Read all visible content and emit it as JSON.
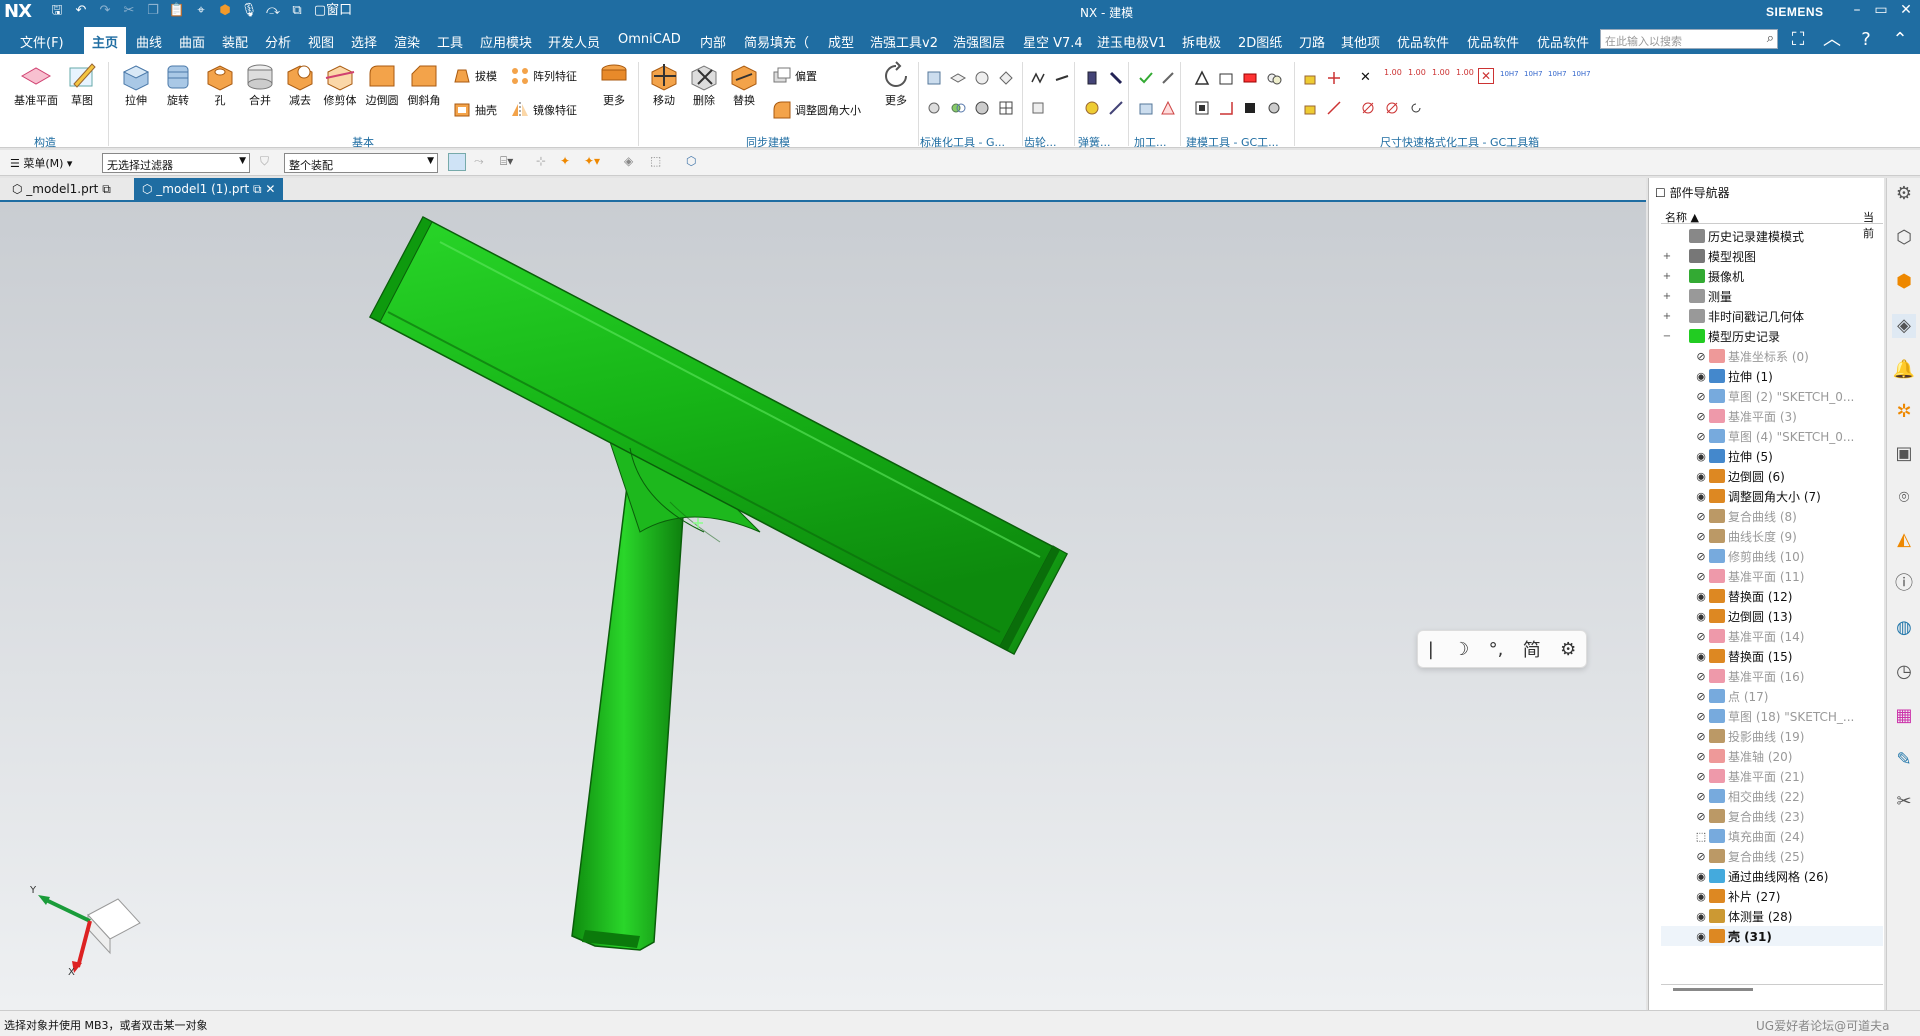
{
  "app": {
    "logo": "NX",
    "title": "NX - 建模",
    "brand": "SIEMENS"
  },
  "menubar": {
    "file": "文件(F)",
    "tabs": [
      "主页",
      "曲线",
      "曲面",
      "装配",
      "分析",
      "视图",
      "选择",
      "渲染",
      "工具",
      "应用模块",
      "开发人员",
      "OmniCAD",
      "内部",
      "简易填充（",
      "成型",
      "浩强工具v2",
      "浩强图层",
      "星空 V7.4",
      "进玉电极V1",
      "拆电极",
      "2D图纸",
      "刀路",
      "其他项",
      "优品软件",
      "优品软件",
      "优品软件"
    ],
    "active_index": 0,
    "search_placeholder": "在此输入以搜索"
  },
  "ribbon": {
    "construct": {
      "buttons": [
        "基准平面",
        "草图"
      ],
      "group": "构造"
    },
    "basic": {
      "buttons": [
        "拉伸",
        "旋转",
        "孔",
        "合并",
        "减去",
        "修剪体",
        "边倒圆",
        "倒斜角",
        "更多"
      ],
      "small": [
        "拔模",
        "抽壳",
        "阵列特征",
        "镜像特征"
      ],
      "group": "基本"
    },
    "sync": {
      "buttons": [
        "移动",
        "删除",
        "替换",
        "更多"
      ],
      "small": [
        "偏置",
        "调整圆角大小"
      ],
      "group": "同步建模"
    },
    "groups": [
      "标准化工具 - G...",
      "齿轮...",
      "弹簧...",
      "加工...",
      "建模工具 - GC工...",
      "尺寸快速格式化工具 - GC工具箱"
    ],
    "dim_labels": [
      "1.00",
      "1.00",
      "1.00",
      "1.00",
      "10H7",
      "10H7",
      "10H7",
      "10H7"
    ]
  },
  "toolbar": {
    "menu": "菜单(M)",
    "filter": "无选择过滤器",
    "assembly": "整个装配"
  },
  "doc_tabs": [
    "_model1.prt",
    "_model1 (1).prt"
  ],
  "ime": {
    "items": [
      "|",
      "☽",
      "°,",
      "简",
      "⚙"
    ]
  },
  "navigator": {
    "title": "部件导航器",
    "col_name": "名称",
    "col_current": "当前",
    "rows": [
      {
        "label": "历史记录建模模式",
        "dim": false,
        "eye": "",
        "tg": "",
        "icon": "#888"
      },
      {
        "label": "模型视图",
        "dim": false,
        "eye": "",
        "tg": "+",
        "icon": "#777"
      },
      {
        "label": "摄像机",
        "dim": false,
        "eye": "",
        "tg": "+",
        "icon": "#3a3"
      },
      {
        "label": "测量",
        "dim": false,
        "eye": "",
        "tg": "+",
        "icon": "#999"
      },
      {
        "label": "非时间戳记几何体",
        "dim": false,
        "eye": "",
        "tg": "+",
        "icon": "#999"
      },
      {
        "label": "模型历史记录",
        "dim": false,
        "eye": "",
        "tg": "−",
        "icon": "#2c2"
      },
      {
        "label": "基准坐标系 (0)",
        "dim": true,
        "eye": "⊘",
        "tg": "",
        "icon": "#e99"
      },
      {
        "label": "拉伸 (1)",
        "dim": false,
        "eye": "◉",
        "tg": "",
        "icon": "#48c"
      },
      {
        "label": "草图 (2) \"SKETCH_0...",
        "dim": true,
        "eye": "⊘",
        "tg": "",
        "icon": "#7ad"
      },
      {
        "label": "基准平面 (3)",
        "dim": true,
        "eye": "⊘",
        "tg": "",
        "icon": "#e9a"
      },
      {
        "label": "草图 (4) \"SKETCH_0...",
        "dim": true,
        "eye": "⊘",
        "tg": "",
        "icon": "#7ad"
      },
      {
        "label": "拉伸 (5)",
        "dim": false,
        "eye": "◉",
        "tg": "",
        "icon": "#48c"
      },
      {
        "label": "边倒圆 (6)",
        "dim": false,
        "eye": "◉",
        "tg": "",
        "icon": "#d82"
      },
      {
        "label": "调整圆角大小 (7)",
        "dim": false,
        "eye": "◉",
        "tg": "",
        "icon": "#d82"
      },
      {
        "label": "复合曲线 (8)",
        "dim": true,
        "eye": "⊘",
        "tg": "",
        "icon": "#b96"
      },
      {
        "label": "曲线长度 (9)",
        "dim": true,
        "eye": "⊘",
        "tg": "",
        "icon": "#b96"
      },
      {
        "label": "修剪曲线 (10)",
        "dim": true,
        "eye": "⊘",
        "tg": "",
        "icon": "#7ad"
      },
      {
        "label": "基准平面 (11)",
        "dim": true,
        "eye": "⊘",
        "tg": "",
        "icon": "#e9a"
      },
      {
        "label": "替换面 (12)",
        "dim": false,
        "eye": "◉",
        "tg": "",
        "icon": "#d82"
      },
      {
        "label": "边倒圆 (13)",
        "dim": false,
        "eye": "◉",
        "tg": "",
        "icon": "#d82"
      },
      {
        "label": "基准平面 (14)",
        "dim": true,
        "eye": "⊘",
        "tg": "",
        "icon": "#e9a"
      },
      {
        "label": "替换面 (15)",
        "dim": false,
        "eye": "◉",
        "tg": "",
        "icon": "#d82"
      },
      {
        "label": "基准平面 (16)",
        "dim": true,
        "eye": "⊘",
        "tg": "",
        "icon": "#e9a"
      },
      {
        "label": "点 (17)",
        "dim": true,
        "eye": "⊘",
        "tg": "",
        "icon": "#7ad"
      },
      {
        "label": "草图 (18) \"SKETCH_...",
        "dim": true,
        "eye": "⊘",
        "tg": "",
        "icon": "#7ad"
      },
      {
        "label": "投影曲线 (19)",
        "dim": true,
        "eye": "⊘",
        "tg": "",
        "icon": "#b96"
      },
      {
        "label": "基准轴 (20)",
        "dim": true,
        "eye": "⊘",
        "tg": "",
        "icon": "#e99"
      },
      {
        "label": "基准平面 (21)",
        "dim": true,
        "eye": "⊘",
        "tg": "",
        "icon": "#e9a"
      },
      {
        "label": "相交曲线 (22)",
        "dim": true,
        "eye": "⊘",
        "tg": "",
        "icon": "#7ad"
      },
      {
        "label": "复合曲线 (23)",
        "dim": true,
        "eye": "⊘",
        "tg": "",
        "icon": "#b96"
      },
      {
        "label": "填充曲面 (24)",
        "dim": true,
        "eye": "⬚",
        "tg": "",
        "icon": "#7ad"
      },
      {
        "label": "复合曲线 (25)",
        "dim": true,
        "eye": "⊘",
        "tg": "",
        "icon": "#b96"
      },
      {
        "label": "通过曲线网格 (26)",
        "dim": false,
        "eye": "◉",
        "tg": "",
        "icon": "#4ad"
      },
      {
        "label": "补片 (27)",
        "dim": false,
        "eye": "◉",
        "tg": "",
        "icon": "#d82"
      },
      {
        "label": "体测量 (28)",
        "dim": false,
        "eye": "◉",
        "tg": "",
        "icon": "#c93"
      },
      {
        "label": "壳 (31)",
        "dim": false,
        "eye": "◉",
        "tg": "",
        "icon": "#d82",
        "bold": true
      }
    ]
  },
  "status": {
    "message": "选择对象并使用 MB3，或者双击某一对象",
    "watermark": "UG爱好者论坛@可道夫a"
  },
  "colors": {
    "accent": "#1f6da2",
    "part": "#1fc21f",
    "part_dark": "#0c7a0c"
  },
  "axes": {
    "y": "Y",
    "x": "X"
  }
}
